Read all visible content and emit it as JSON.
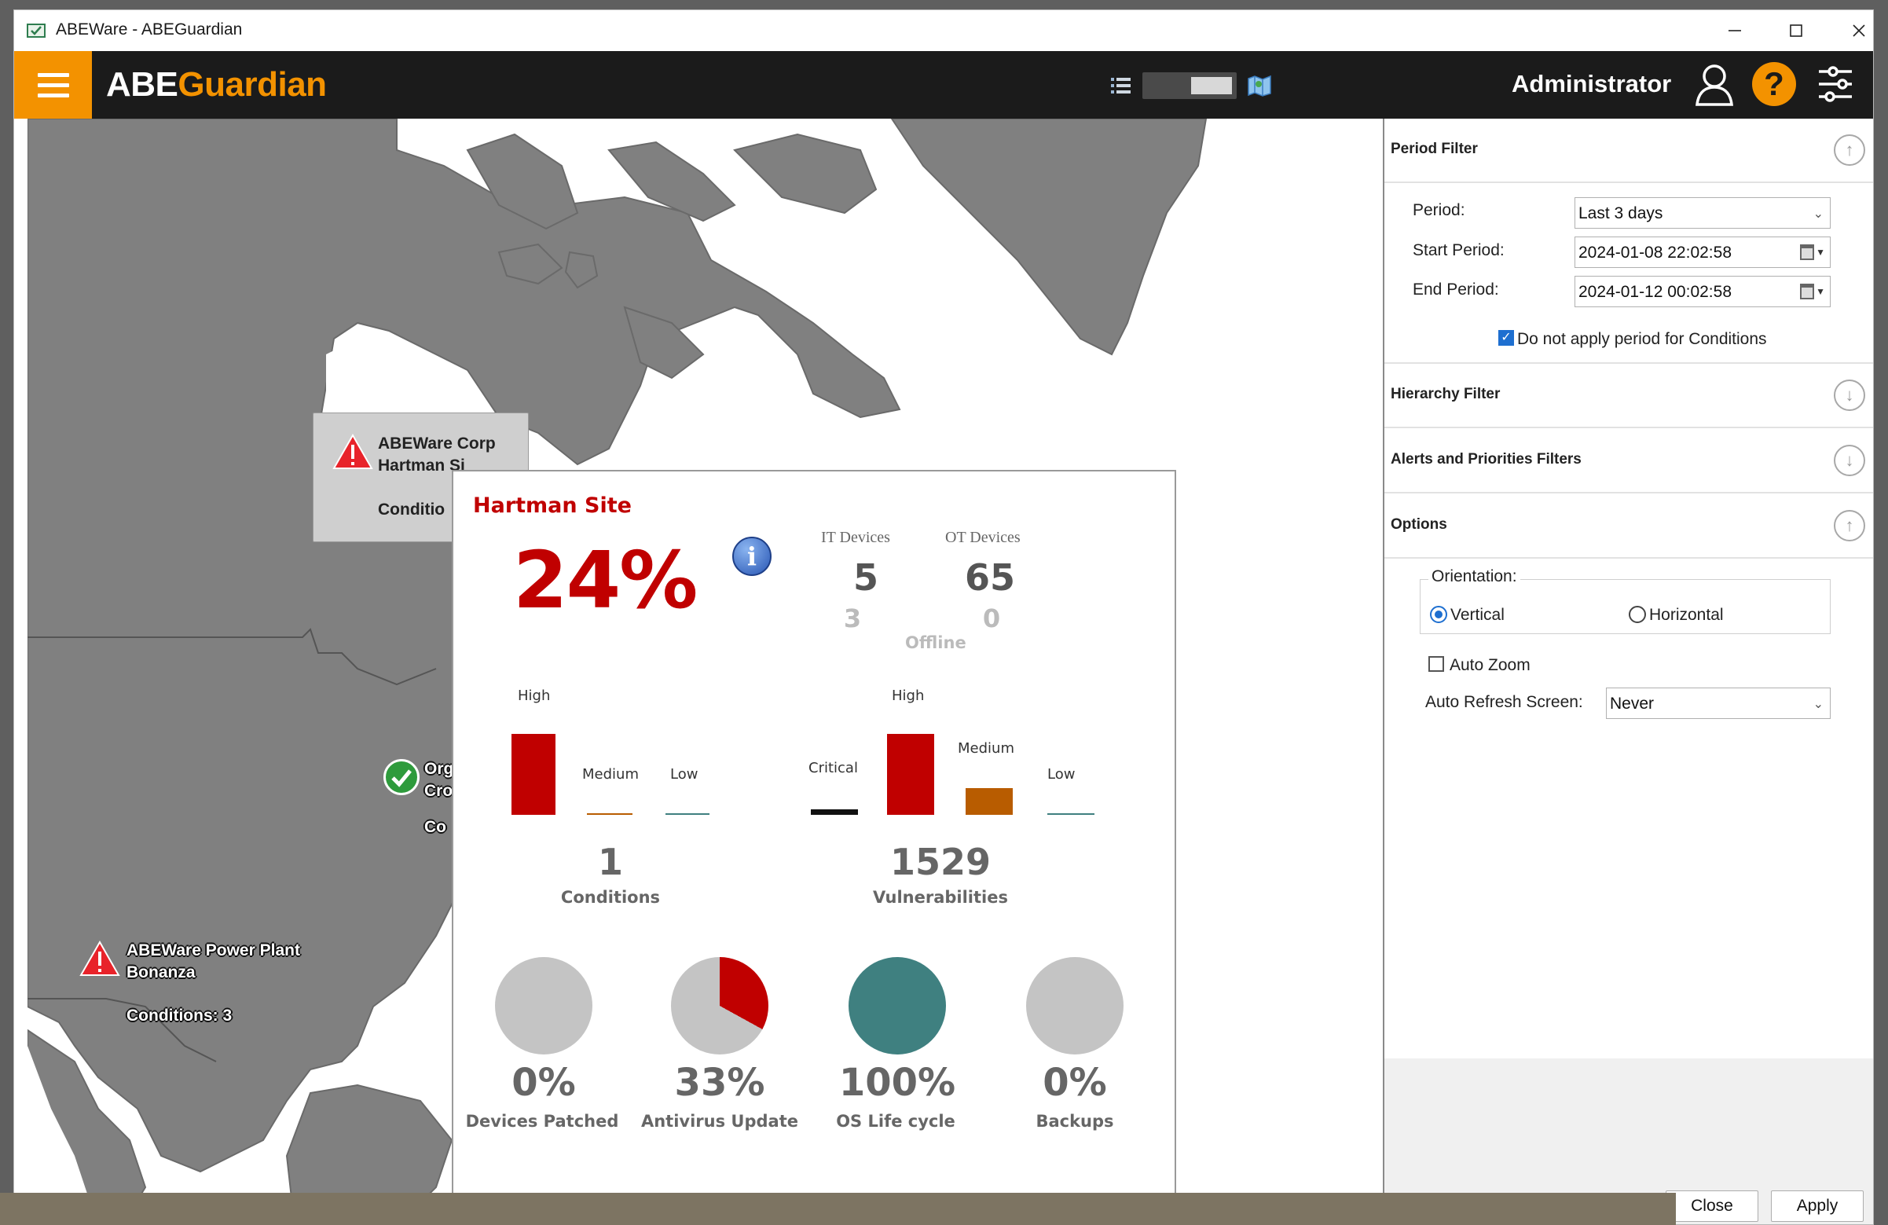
{
  "window": {
    "title": "ABEWare - ABEGuardian"
  },
  "appbar": {
    "brand_part1": "ABE",
    "brand_part2": "Guardian",
    "user": "Administrator",
    "help_glyph": "?"
  },
  "map": {
    "callout": {
      "line1": "ABEWare Corp",
      "line2": "Hartman Si",
      "conditions": "Conditio"
    },
    "site_green": {
      "line1": "Org",
      "line2": "Cro",
      "conditions": "Co"
    },
    "site_power": {
      "line1": "ABEWare Power Plant",
      "line2": "Bonanza",
      "conditions": "Conditions: 3"
    }
  },
  "popup": {
    "site_title": "Hartman Site",
    "overall_pct": "24%",
    "info_glyph": "i",
    "it_devices_label": "IT Devices",
    "ot_devices_label": "OT Devices",
    "it_devices": "5",
    "ot_devices": "65",
    "it_offline": "3",
    "ot_offline": "0",
    "offline_label": "Offline",
    "conditions": {
      "labels": [
        "High",
        "Medium",
        "Low"
      ],
      "values": [
        1,
        0,
        0
      ],
      "total": "1",
      "caption": "Conditions"
    },
    "vulnerabilities": {
      "labels": [
        "Critical",
        "High",
        "Medium",
        "Low"
      ],
      "values": [
        0,
        1.0,
        0.33,
        0
      ],
      "total": "1529",
      "caption": "Vulnerabilities"
    },
    "pies": [
      {
        "pct": "0%",
        "label": "Devices Patched",
        "fraction": 0.0
      },
      {
        "pct": "33%",
        "label": "Antivirus Update",
        "fraction": 0.33
      },
      {
        "pct": "100%",
        "label": "OS Life cycle",
        "fraction": 1.0
      },
      {
        "pct": "0%",
        "label": "Backups",
        "fraction": 0.0
      }
    ]
  },
  "panel": {
    "period_filter": "Period Filter",
    "period_label": "Period:",
    "period_value": "Last 3 days",
    "start_label": "Start Period:",
    "start_value": "2024-01-08 22:02:58",
    "end_label": "End Period:",
    "end_value": "2024-01-12 00:02:58",
    "no_period_label": "Do not apply period for Conditions",
    "hierarchy_filter": "Hierarchy Filter",
    "alerts_filter": "Alerts and Priorities Filters",
    "options": "Options",
    "orientation_label": "Orientation:",
    "vertical": "Vertical",
    "horizontal": "Horizontal",
    "auto_zoom": "Auto Zoom",
    "auto_refresh_label": "Auto Refresh Screen:",
    "auto_refresh_value": "Never",
    "close_btn": "Close",
    "apply_btn": "Apply"
  },
  "colors": {
    "accent": "#f39200",
    "danger": "#c00000",
    "medium": "#b85c00",
    "ok": "#3f8080",
    "pie_base": "#c4c4c4"
  }
}
